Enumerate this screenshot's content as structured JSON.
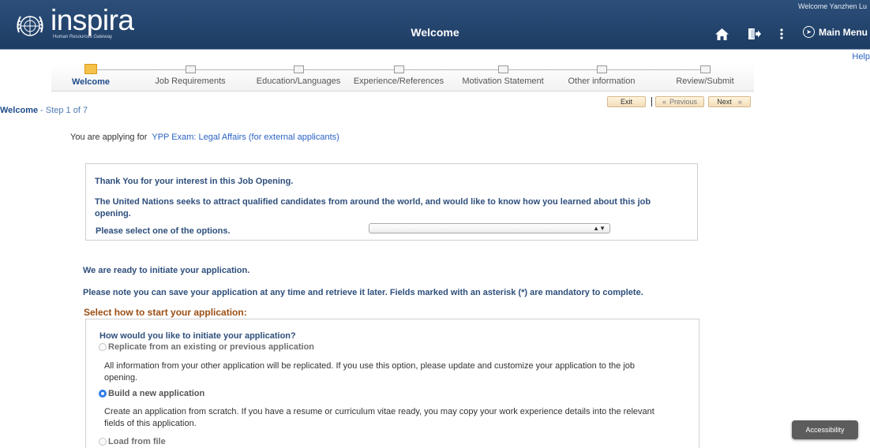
{
  "header": {
    "logo_text": "inspira",
    "logo_subtitle": "Human Resources Gateway",
    "title": "Welcome",
    "welcome_user": "Welcome Yanzhen Lu",
    "main_menu_label": "Main Menu",
    "icons": [
      "home-icon",
      "signout-icon",
      "more-vertical-icon",
      "compass-icon"
    ],
    "background_color": "#1d3c63"
  },
  "help_link": "Help",
  "steps": [
    {
      "label": "Welcome",
      "active": true
    },
    {
      "label": "Job Requirements",
      "active": false
    },
    {
      "label": "Education/Languages",
      "active": false
    },
    {
      "label": "Experience/References",
      "active": false
    },
    {
      "label": "Motivation Statement",
      "active": false
    },
    {
      "label": "Other information",
      "active": false
    },
    {
      "label": "Review/Submit",
      "active": false
    }
  ],
  "step_indicator": {
    "page": "Welcome",
    "rest": " - Step 1 of 7"
  },
  "buttons": {
    "exit": "Exit",
    "previous": "Previous",
    "next": "Next"
  },
  "applying": {
    "prefix": "You are applying for",
    "job": "YPP Exam: Legal Affairs (for external applicants)"
  },
  "interest_panel": {
    "thanks": "Thank You for your interest in this Job Opening.",
    "un_text": "The United Nations seeks to attract qualified candidates from around the world, and would like to know how you learned about this job opening.",
    "select_label": "Please select one of the options.",
    "select_value": ""
  },
  "ready_text": "We are ready to initiate your application.",
  "note_text": "Please note you can save your application at any time and retrieve it later. Fields marked with an asterisk (*) are mandatory to complete.",
  "section_heading": "Select how to start your application:",
  "init_panel": {
    "question": "How would you like to initiate your application?",
    "options": [
      {
        "label": "Replicate from an existing or previous application",
        "selected": false,
        "description": "All information from your other application will be replicated. If you use this option, please update and customize your application to the job opening."
      },
      {
        "label": "Build a new application",
        "selected": true,
        "description": "Create an application from scratch. If you have a resume or curriculum vitae ready, you may copy your work experience details into the relevant fields of this application."
      },
      {
        "label": "Load from file",
        "selected": false,
        "description": ""
      }
    ]
  },
  "accessibility_label": "Accessibility"
}
